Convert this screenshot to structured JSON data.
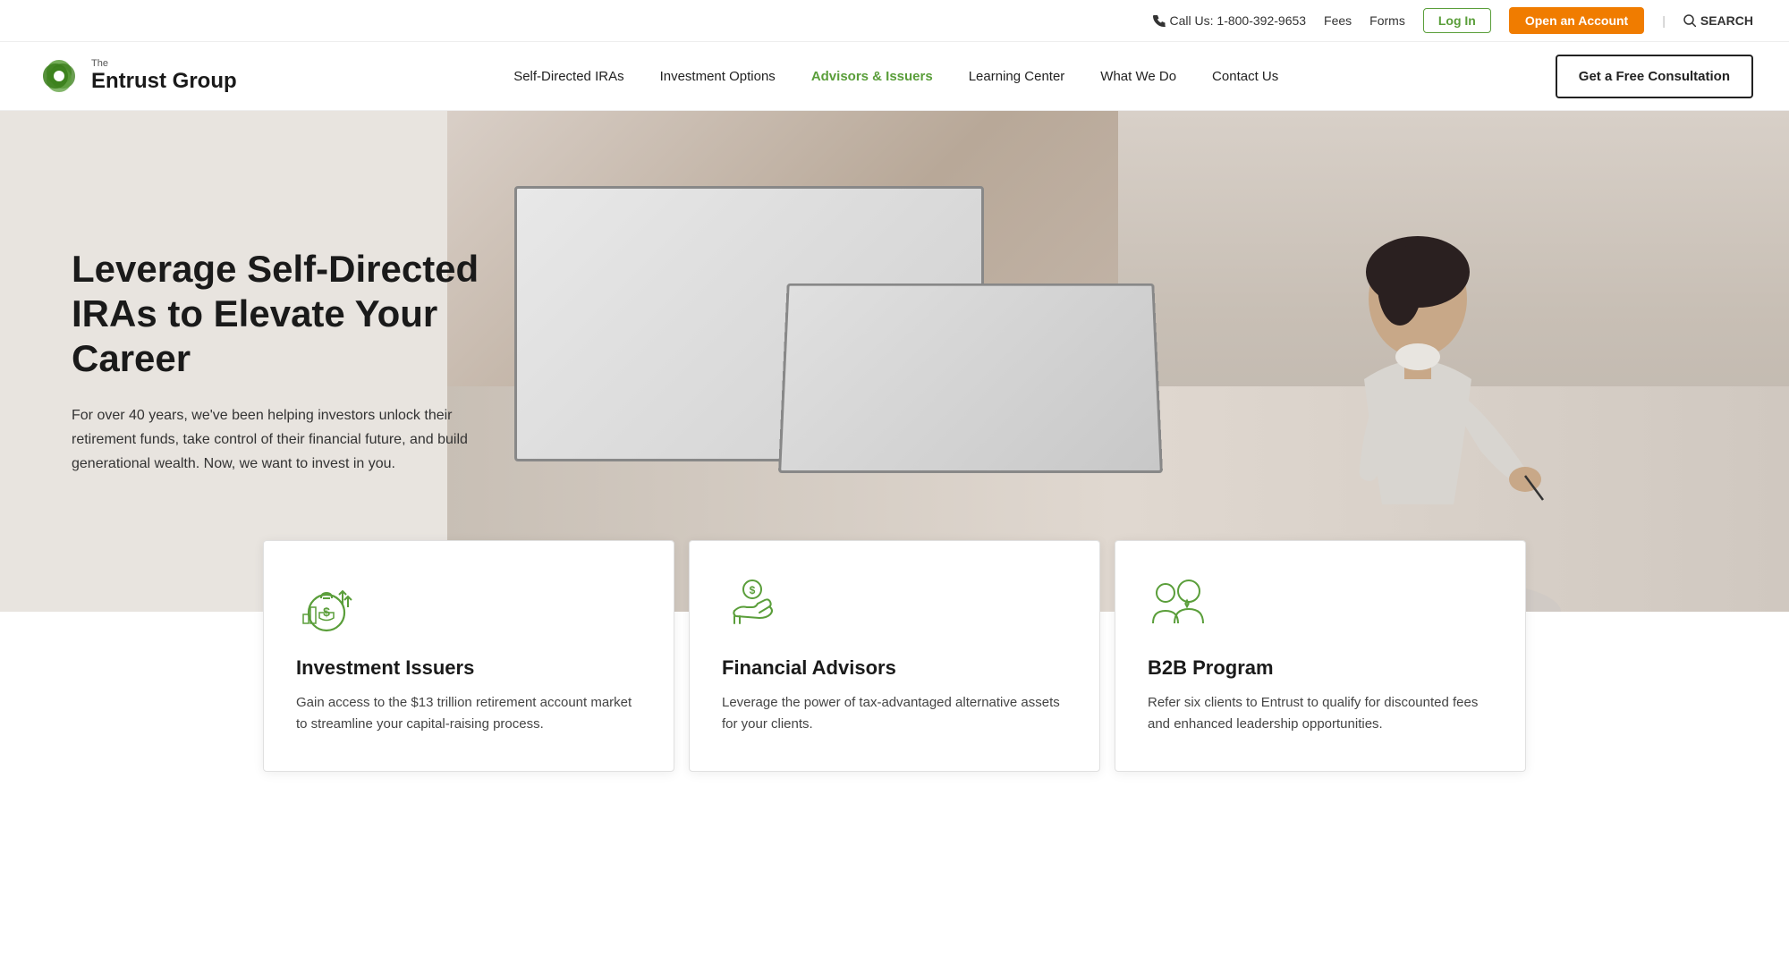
{
  "topbar": {
    "phone_icon": "phone",
    "phone_text": "Call Us: 1-800-392-9653",
    "fees_label": "Fees",
    "forms_label": "Forms",
    "login_label": "Log In",
    "open_account_label": "Open an Account",
    "search_label": "SEARCH"
  },
  "nav": {
    "logo_the": "The",
    "logo_name": "Entrust Group",
    "links": [
      {
        "label": "Self-Directed IRAs",
        "active": false
      },
      {
        "label": "Investment Options",
        "active": false
      },
      {
        "label": "Advisors & Issuers",
        "active": true
      },
      {
        "label": "Learning Center",
        "active": false
      },
      {
        "label": "What We Do",
        "active": false
      },
      {
        "label": "Contact Us",
        "active": false
      }
    ],
    "cta_label": "Get a Free Consultation"
  },
  "hero": {
    "title": "Leverage Self-Directed IRAs to Elevate Your Career",
    "subtitle": "For over 40 years, we've been helping investors unlock their retirement funds, take control of their financial future, and build generational wealth. Now, we want to invest in you."
  },
  "cards": [
    {
      "id": "investment-issuers",
      "icon": "money-bag",
      "title": "Investment Issuers",
      "description": "Gain access to the $13 trillion retirement account market to streamline your capital-raising process."
    },
    {
      "id": "financial-advisors",
      "icon": "handshake",
      "title": "Financial Advisors",
      "description": "Leverage the power of tax-advantaged alternative assets for your clients."
    },
    {
      "id": "b2b-program",
      "icon": "group",
      "title": "B2B Program",
      "description": "Refer six clients to Entrust to qualify for discounted fees and enhanced leadership opportunities."
    }
  ]
}
